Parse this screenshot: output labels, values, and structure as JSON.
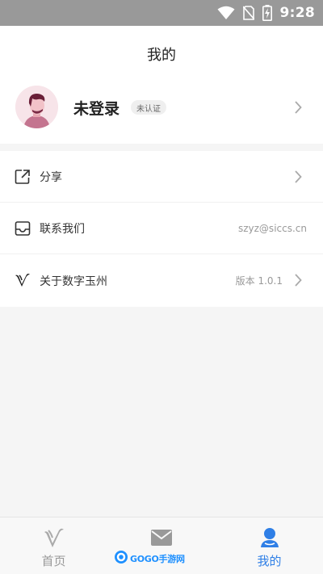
{
  "status_bar": {
    "time": "9:28",
    "icons": [
      "wifi-icon",
      "no-sim-icon",
      "battery-charging-icon"
    ]
  },
  "header": {
    "title": "我的"
  },
  "profile": {
    "name": "未登录",
    "badge": "未认证",
    "avatar_icon": "user-avatar-icon"
  },
  "menu": {
    "items": [
      {
        "label": "分享",
        "icon": "share-icon",
        "value": ""
      },
      {
        "label": "联系我们",
        "icon": "inbox-icon",
        "value": "szyz@siccs.cn"
      },
      {
        "label": "关于数字玉州",
        "icon": "app-logo-icon",
        "value": "版本 1.0.1"
      }
    ]
  },
  "tabbar": {
    "tabs": [
      {
        "label": "首页",
        "icon": "home-logo-icon",
        "active": false
      },
      {
        "label": "",
        "icon": "mail-icon",
        "active": false
      },
      {
        "label": "我的",
        "icon": "person-icon",
        "active": true
      }
    ]
  },
  "watermark": {
    "text": "GOGO手游网"
  },
  "colors": {
    "accent": "#2f7fe6",
    "statusbar": "#999999"
  }
}
